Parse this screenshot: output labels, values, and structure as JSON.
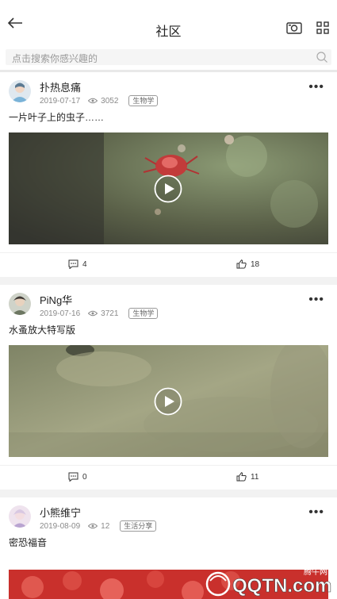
{
  "header": {
    "title": "社区"
  },
  "search": {
    "placeholder": "点击搜索你感兴趣的"
  },
  "posts": [
    {
      "user": "扑热息痛",
      "date": "2019-07-17",
      "views": "3052",
      "tag": "生物学",
      "caption": "一片叶子上的虫子……",
      "comments": "4",
      "likes": "18"
    },
    {
      "user": "PiNg华",
      "date": "2019-07-16",
      "views": "3721",
      "tag": "生物学",
      "caption": "水蚤放大特写版",
      "comments": "0",
      "likes": "11"
    },
    {
      "user": "小熊维宁",
      "date": "2019-08-09",
      "views": "12",
      "tag": "生活分享",
      "caption": "密恐福音"
    }
  ],
  "watermark": {
    "text": "QQTN.com",
    "sub": "腾牛网"
  }
}
